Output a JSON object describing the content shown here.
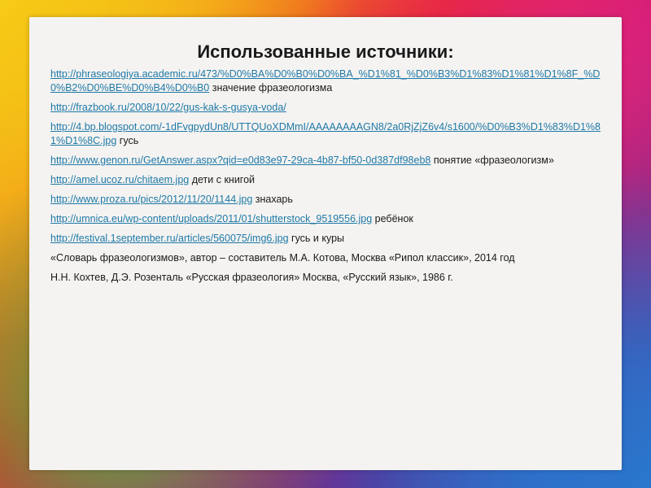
{
  "slide": {
    "title": "Использованные источники:",
    "sources": [
      {
        "url": "http://phraseologiya.academic.ru/473/%D0%BA%D0%B0%D0%BA_%D1%81_%D0%B3%D1%83%D1%81%D1%8F_%D0%B2%D0%BE%D0%B4%D0%B0",
        "desc": " значение фразеологизма"
      },
      {
        "url": "http://frazbook.ru/2008/10/22/gus-kak-s-gusya-voda/",
        "desc": ""
      },
      {
        "url": "http://4.bp.blogspot.com/-1dFvgpydUn8/UTTQUoXDMmI/AAAAAAAAGN8/2a0RjZjZ6v4/s1600/%D0%B3%D1%83%D1%81%D1%8C.jpg",
        "desc": " гусь"
      },
      {
        "url": "http://www.genon.ru/GetAnswer.aspx?qid=e0d83e97-29ca-4b87-bf50-0d387df98eb8",
        "desc": " понятие «фразеологизм»"
      },
      {
        "url": "http://amel.ucoz.ru/chitaem.jpg",
        "desc": " дети с книгой"
      },
      {
        "url": "http://www.proza.ru/pics/2012/11/20/1144.jpg",
        "desc": " знахарь"
      },
      {
        "url": "http://umnica.eu/wp-content/uploads/2011/01/shutterstock_9519556.jpg",
        "desc": " ребёнок"
      },
      {
        "url": "http://festival.1september.ru/articles/560075/img6.jpg",
        "desc": " гусь и куры"
      }
    ],
    "books": [
      "«Словарь фразеологизмов», автор – составитель М.А. Котова, Москва «Рипол классик», 2014 год",
      "Н.Н. Кохтев, Д.Э. Розенталь «Русская фразеология» Москва, «Русский язык», 1986 г."
    ]
  }
}
